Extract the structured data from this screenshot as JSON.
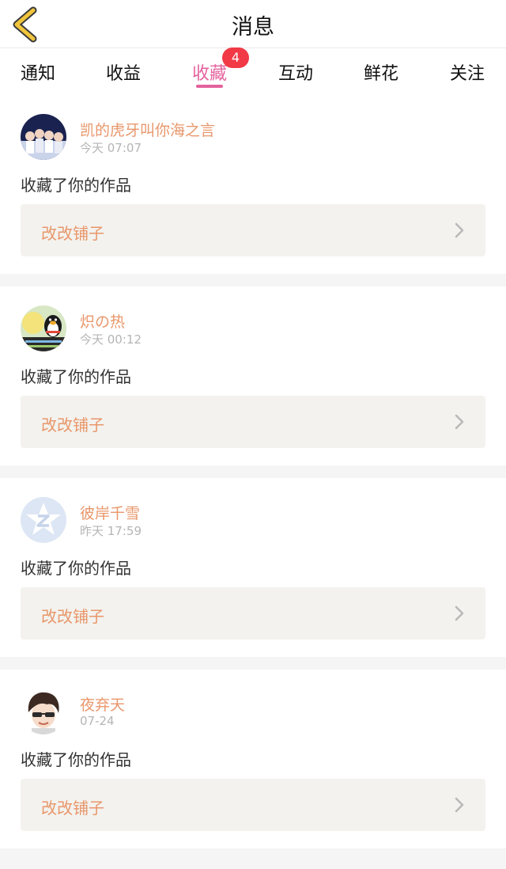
{
  "header": {
    "title": "消息"
  },
  "tabs": [
    {
      "label": "通知"
    },
    {
      "label": "收益"
    },
    {
      "label": "收藏",
      "badge": "4"
    },
    {
      "label": "互动"
    },
    {
      "label": "鲜花"
    },
    {
      "label": "关注"
    }
  ],
  "items": [
    {
      "user": "凯的虎牙叫你海之言",
      "time": "今天 07:07",
      "action": "收藏了你的作品",
      "work": "改改铺子",
      "avatar_icon": "group-photo-avatar"
    },
    {
      "user": "炽の热",
      "time": "今天 00:12",
      "action": "收藏了你的作品",
      "work": "改改铺子",
      "avatar_icon": "qq-penguin-avatar"
    },
    {
      "user": "彼岸千雪",
      "time": "昨天 17:59",
      "action": "收藏了你的作品",
      "work": "改改铺子",
      "avatar_icon": "qzone-star-avatar"
    },
    {
      "user": "夜弃天",
      "time": "07-24",
      "action": "收藏了你的作品",
      "work": "改改铺子",
      "avatar_icon": "anime-boy-avatar"
    }
  ],
  "colors": {
    "accent": "#e4629e",
    "badge": "#f13a46",
    "username": "#e8976b",
    "back_icon": "#f0c43c"
  }
}
